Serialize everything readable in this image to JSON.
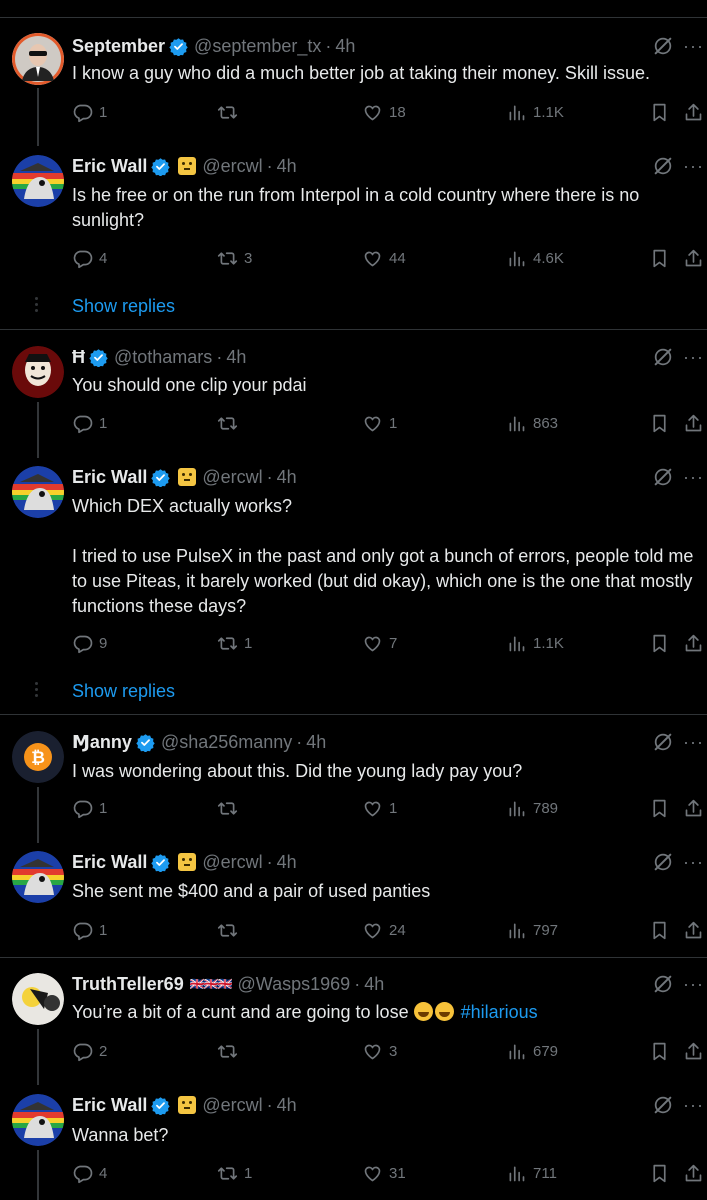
{
  "tweets": [
    {
      "name": "September",
      "handle": "@september_tx",
      "time": "4h",
      "text": "I know a guy who did a much better job at taking their money. Skill issue.",
      "replies": "1",
      "reposts": "",
      "likes": "18",
      "views": "1.1K"
    },
    {
      "name": "Eric Wall",
      "handle": "@ercwl",
      "time": "4h",
      "text": "Is he free or on the run from Interpol in a cold country where there is no sunlight?",
      "replies": "4",
      "reposts": "3",
      "likes": "44",
      "views": "4.6K"
    },
    {
      "name": "Ħ",
      "handle": "@tothamars",
      "time": "4h",
      "text": "You should one clip your pdai",
      "replies": "1",
      "reposts": "",
      "likes": "1",
      "views": "863"
    },
    {
      "name": "Eric Wall",
      "handle": "@ercwl",
      "time": "4h",
      "text": "Which DEX actually works?\n\nI tried to use PulseX in the past and only got a bunch of errors, people told me to use Piteas, it barely worked (but did okay), which one is the one that mostly functions these days?",
      "replies": "9",
      "reposts": "1",
      "likes": "7",
      "views": "1.1K"
    },
    {
      "name": "Ɱanny",
      "handle": "@sha256manny",
      "time": "4h",
      "text": "I was wondering about this. Did the young lady pay you?",
      "replies": "1",
      "reposts": "",
      "likes": "1",
      "views": "789"
    },
    {
      "name": "Eric Wall",
      "handle": "@ercwl",
      "time": "4h",
      "text": "She sent me $400 and a pair of used panties",
      "replies": "1",
      "reposts": "",
      "likes": "24",
      "views": "797"
    },
    {
      "name": "TruthTeller69",
      "flags": "🇬🇧🇬🇧🇬🇧",
      "handle": "@Wasps1969",
      "time": "4h",
      "text": "You’re a bit of a cunt and are going to lose",
      "hashtag": "#hilarious",
      "replies": "2",
      "reposts": "",
      "likes": "3",
      "views": "679"
    },
    {
      "name": "Eric Wall",
      "handle": "@ercwl",
      "time": "4h",
      "text": "Wanna bet?",
      "replies": "4",
      "reposts": "1",
      "likes": "31",
      "views": "711"
    }
  ],
  "show_replies_label": "Show replies",
  "more_label": "···",
  "dot": "·",
  "icons": [
    "reply-icon",
    "repost-icon",
    "like-icon",
    "views-icon",
    "bookmark-icon",
    "share-icon",
    "grok-icon",
    "verified-icon"
  ],
  "colors": {
    "accent": "#1d9bf0",
    "muted": "#71767b",
    "text": "#e7e9ea",
    "border": "#2f3336"
  }
}
